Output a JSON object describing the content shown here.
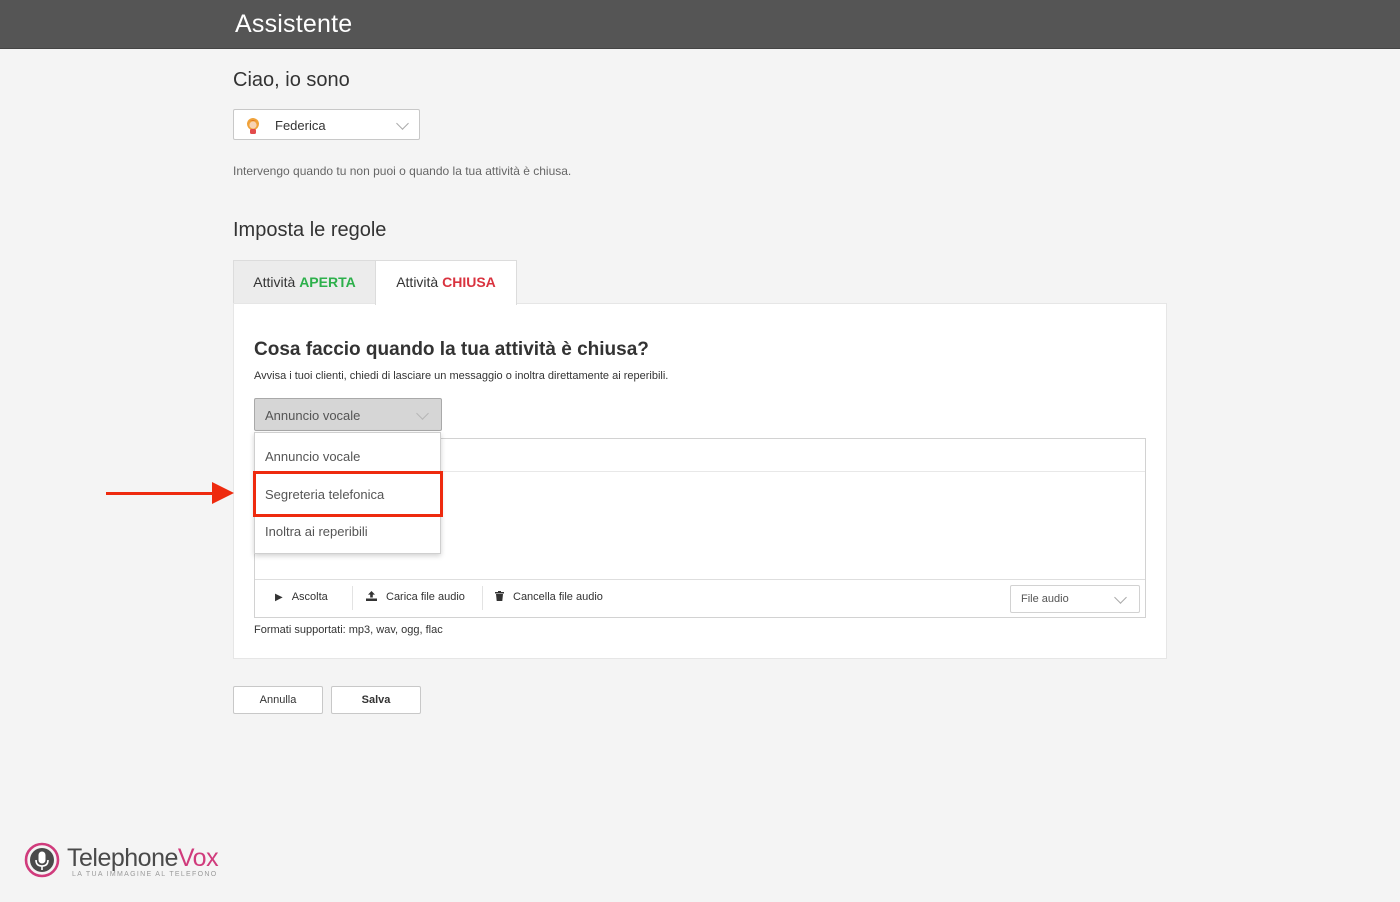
{
  "header": {
    "title": "Assistente"
  },
  "intro": {
    "heading": "Ciao, io sono",
    "assistant_name": "Federica",
    "description": "Intervengo quando tu non puoi o quando la tua attività è chiusa."
  },
  "rules": {
    "heading": "Imposta le regole",
    "tabs": [
      {
        "prefix": "Attività",
        "status": "APERTA",
        "status_color": "#2db04b",
        "active": false
      },
      {
        "prefix": "Attività",
        "status": "CHIUSA",
        "status_color": "#d9333f",
        "active": true
      }
    ]
  },
  "panel": {
    "title": "Cosa faccio quando la tua attività è chiusa?",
    "subtitle": "Avvisa i tuoi clienti, chiedi di lasciare un messaggio o inoltra direttamente ai reperibili.",
    "mode_select": {
      "selected": "Annuncio vocale",
      "options": [
        "Annuncio vocale",
        "Segreteria telefonica",
        "Inoltra ai reperibili"
      ],
      "highlighted_option": "Segreteria telefonica"
    },
    "audio_toolbar": {
      "play_label": "Ascolta",
      "upload_label": "Carica file audio",
      "delete_label": "Cancella file audio",
      "file_select_value": "File audio"
    },
    "formats_note": "Formati supportati: mp3, wav, ogg, flac"
  },
  "actions": {
    "cancel_label": "Annulla",
    "save_label": "Salva"
  },
  "logo": {
    "word_main": "Telephone",
    "word_accent": "Vox",
    "tagline": "LA TUA IMMAGINE AL TELEFONO",
    "accent_color": "#d03b7c"
  },
  "annotation": {
    "color": "#ee2a0e"
  }
}
